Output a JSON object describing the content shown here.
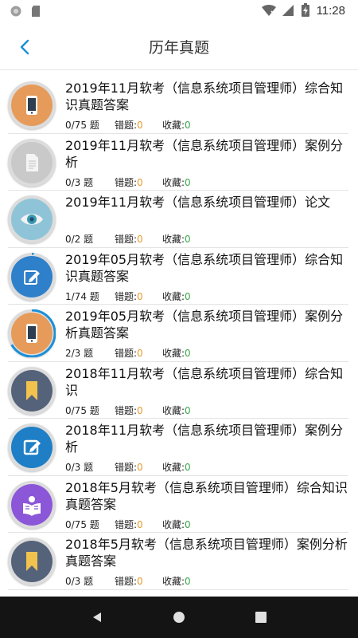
{
  "status_bar": {
    "time": "11:28",
    "icons": [
      "record-icon",
      "sdcard-icon",
      "wifi-icon",
      "signal-icon",
      "battery-charging-icon"
    ]
  },
  "header": {
    "title": "历年真题",
    "back_icon": "chevron-left-icon"
  },
  "colors": {
    "accent": "#1a8fd8",
    "highlight_wrong": "#e79a2c",
    "highlight_fav": "#3aa84a"
  },
  "exams": [
    {
      "title": "2019年11月软考（信息系统项目管理师）综合知识真题答案",
      "count": "0/75 题",
      "wrong_label": "错题:",
      "wrong": "0",
      "fav_label": "收藏:",
      "fav": "0",
      "icon": "phone-icon",
      "progress": 0
    },
    {
      "title": "2019年11月软考（信息系统项目管理师）案例分析",
      "count": "0/3 题",
      "wrong_label": "错题:",
      "wrong": "0",
      "fav_label": "收藏:",
      "fav": "0",
      "icon": "document-icon",
      "progress": 0
    },
    {
      "title": "2019年11月软考（信息系统项目管理师）论文",
      "count": "0/2 题",
      "wrong_label": "错题:",
      "wrong": "0",
      "fav_label": "收藏:",
      "fav": "0",
      "icon": "eye-icon",
      "progress": 0
    },
    {
      "title": "2019年05月软考（信息系统项目管理师）综合知识真题答案",
      "count": "1/74 题",
      "wrong_label": "错题:",
      "wrong": "0",
      "fav_label": "收藏:",
      "fav": "0",
      "icon": "edit-icon",
      "progress": 0.0135
    },
    {
      "title": "2019年05月软考（信息系统项目管理师）案例分析真题答案",
      "count": "2/3 题",
      "wrong_label": "错题:",
      "wrong": "0",
      "fav_label": "收藏:",
      "fav": "0",
      "icon": "phone-icon",
      "progress": 0.667
    },
    {
      "title": "2018年11月软考（信息系统项目管理师）综合知识",
      "count": "0/75 题",
      "wrong_label": "错题:",
      "wrong": "0",
      "fav_label": "收藏:",
      "fav": "0",
      "icon": "bookmark-icon",
      "progress": 0
    },
    {
      "title": "2018年11月软考（信息系统项目管理师）案例分析",
      "count": "0/3 题",
      "wrong_label": "错题:",
      "wrong": "0",
      "fav_label": "收藏:",
      "fav": "0",
      "icon": "edit-square-icon",
      "progress": 0
    },
    {
      "title": "2018年5月软考（信息系统项目管理师）综合知识真题答案",
      "count": "0/75 题",
      "wrong_label": "错题:",
      "wrong": "0",
      "fav_label": "收藏:",
      "fav": "0",
      "icon": "reader-icon",
      "progress": 0
    },
    {
      "title": "2018年5月软考（信息系统项目管理师）案例分析真题答案",
      "count": "0/3 题",
      "wrong_label": "错题:",
      "wrong": "0",
      "fav_label": "收藏:",
      "fav": "0",
      "icon": "bookmark-icon",
      "progress": 0
    }
  ],
  "nav_bar": {
    "icons": [
      "back-triangle-icon",
      "home-circle-icon",
      "recents-square-icon"
    ]
  }
}
